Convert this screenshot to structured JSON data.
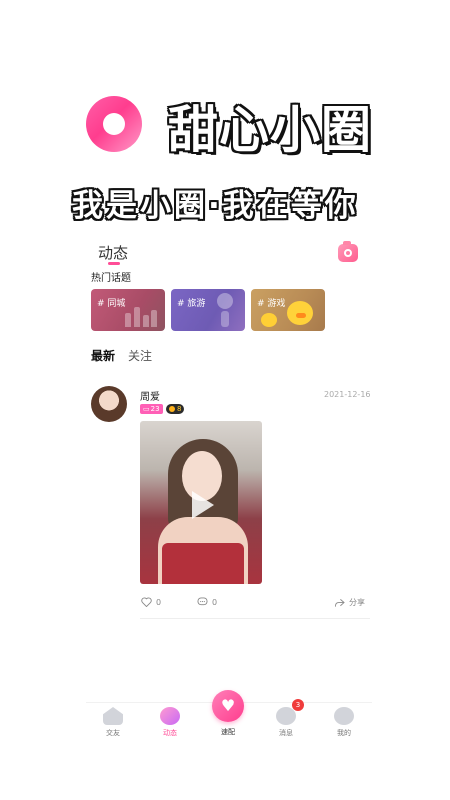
{
  "promo": {
    "app_name": "甜心小圈",
    "slogan": "我是小圈·我在等你"
  },
  "header": {
    "title": "动态",
    "camera_icon": "camera-icon",
    "accent_color": "#ff4d97"
  },
  "hot_topics": {
    "label": "热门话题",
    "items": [
      {
        "label": "# 同城"
      },
      {
        "label": "# 旅游"
      },
      {
        "label": "# 游戏"
      }
    ]
  },
  "feed_tabs": {
    "latest": "最新",
    "follow": "关注",
    "active": "最新"
  },
  "post": {
    "user_name": "周爱",
    "date": "2021-12-16",
    "message_badge": "23",
    "level_badge": "8",
    "media_type": "video",
    "like_count": "0",
    "comment_count": "0",
    "share_label": "分享"
  },
  "bottom_nav": {
    "items": [
      {
        "label": "交友",
        "icon": "home-icon"
      },
      {
        "label": "动态",
        "icon": "planet-icon"
      },
      {
        "label": "速配",
        "icon": "heart-icon"
      },
      {
        "label": "消息",
        "icon": "chat-icon"
      },
      {
        "label": "我的",
        "icon": "user-icon"
      }
    ],
    "active": "动态",
    "message_badge": "3"
  }
}
